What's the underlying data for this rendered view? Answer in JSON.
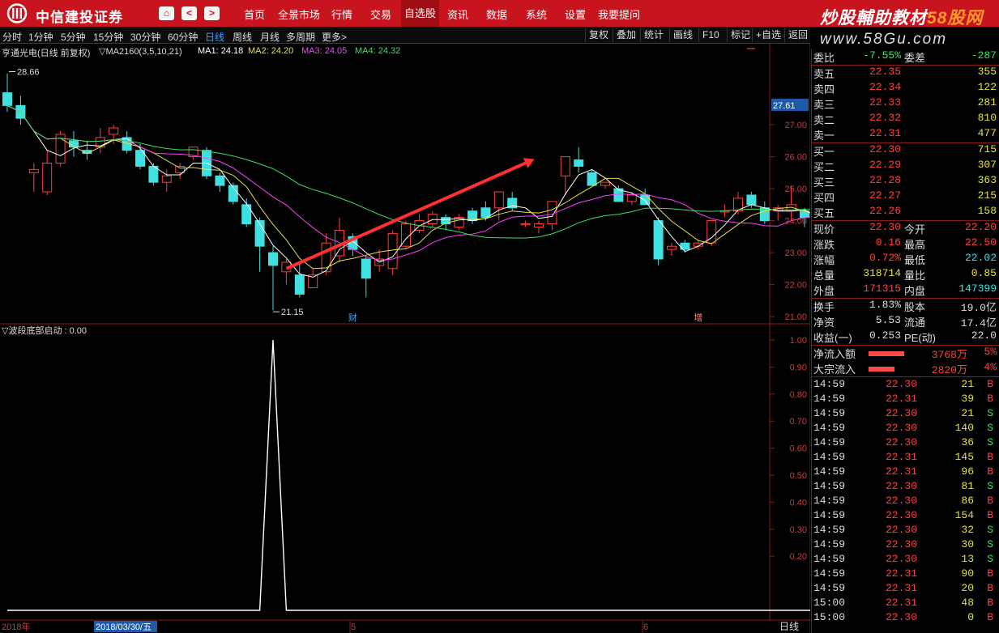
{
  "header": {
    "brand": "中信建投证券",
    "nav_back": "<",
    "nav_fwd": ">",
    "menus": [
      "首页",
      "全景市场",
      "行情",
      "交易",
      "自选股",
      "资讯",
      "数据",
      "系统",
      "设置",
      "我要提问"
    ],
    "active_menu": "自选股",
    "watermark1_a": "炒股輔助教材",
    "watermark1_b": "58股网",
    "watermark2": "www.58Gu.com"
  },
  "periods": [
    "分时",
    "1分钟",
    "5分钟",
    "15分钟",
    "30分钟",
    "60分钟",
    "日线",
    "周线",
    "月线",
    "多周期",
    "更多>"
  ],
  "selected_period": "日线",
  "tools": [
    "复权",
    "叠加",
    "统计",
    "画线",
    "F10",
    "标记",
    "+自选",
    "返回"
  ],
  "chart_title": "亨通光电(日线 前复权)",
  "ma_formula": "▽MA2160(3,5,10,21)",
  "ma_values": [
    "MA1: 24.18",
    "MA2: 24.20",
    "MA3: 24.05",
    "MA4: 24.32"
  ],
  "price_axis": [
    "27.00",
    "26.00",
    "25.00",
    "24.00",
    "23.00",
    "22.00",
    "21.00"
  ],
  "price_marker": "27.61",
  "high_label": "28.66",
  "low_label": "21.15",
  "event_cai": "财",
  "event_zeng": "增",
  "indicator_title": "▽波段底部启动 : 0.00",
  "indicator_axis": [
    "1.00",
    "0.90",
    "0.80",
    "0.70",
    "0.60",
    "0.50",
    "0.40",
    "0.30",
    "0.20"
  ],
  "date_left": "2018年",
  "date_cursor": "2018/03/30/五",
  "date_marks": [
    "5",
    "6"
  ],
  "bottom_tab": "日线",
  "colors": {
    "up": "#ff4040",
    "down": "#40e0e0",
    "ma1": "#ffffff",
    "ma2": "#e8e040",
    "ma3": "#ff40ff",
    "ma4": "#40e060",
    "arrow": "#ff3030"
  },
  "chart_data": {
    "type": "candlestick",
    "candles": [
      [
        28.0,
        28.6,
        27.4,
        27.6
      ],
      [
        27.6,
        27.9,
        27.0,
        27.2
      ],
      [
        25.5,
        25.8,
        24.9,
        25.6
      ],
      [
        24.9,
        26.2,
        24.8,
        25.8
      ],
      [
        25.8,
        26.8,
        25.7,
        26.7
      ],
      [
        26.5,
        26.8,
        26.0,
        26.3
      ],
      [
        26.2,
        26.5,
        25.9,
        26.1
      ],
      [
        26.3,
        26.9,
        26.1,
        26.6
      ],
      [
        26.7,
        27.0,
        26.4,
        26.9
      ],
      [
        26.6,
        26.8,
        26.1,
        26.2
      ],
      [
        26.2,
        26.4,
        25.6,
        25.7
      ],
      [
        25.7,
        25.8,
        25.1,
        25.2
      ],
      [
        25.2,
        25.6,
        24.9,
        25.4
      ],
      [
        25.5,
        25.8,
        25.3,
        25.7
      ],
      [
        26.0,
        26.3,
        25.9,
        26.3
      ],
      [
        26.2,
        26.3,
        25.3,
        25.4
      ],
      [
        25.4,
        25.5,
        24.9,
        25.1
      ],
      [
        25.1,
        25.2,
        24.5,
        24.6
      ],
      [
        24.5,
        24.7,
        23.8,
        23.9
      ],
      [
        24.0,
        24.1,
        22.4,
        23.2
      ],
      [
        23.0,
        23.2,
        21.2,
        22.6
      ],
      [
        22.4,
        22.8,
        22.0,
        22.7
      ],
      [
        22.3,
        22.7,
        21.6,
        21.7
      ],
      [
        21.9,
        22.5,
        21.9,
        22.3
      ],
      [
        22.4,
        23.6,
        22.3,
        23.3
      ],
      [
        22.9,
        24.1,
        22.7,
        23.7
      ],
      [
        23.5,
        23.6,
        22.9,
        23.1
      ],
      [
        22.8,
        22.9,
        21.6,
        22.2
      ],
      [
        22.6,
        23.1,
        22.4,
        22.8
      ],
      [
        22.5,
        23.7,
        22.3,
        23.6
      ],
      [
        23.2,
        24.0,
        23.1,
        23.9
      ],
      [
        23.7,
        24.2,
        23.6,
        24.0
      ],
      [
        23.9,
        24.3,
        23.8,
        24.2
      ],
      [
        24.1,
        24.2,
        23.7,
        23.9
      ],
      [
        23.8,
        24.2,
        23.7,
        24.1
      ],
      [
        24.3,
        24.4,
        23.9,
        24.0
      ],
      [
        24.4,
        24.6,
        24.0,
        24.1
      ],
      [
        24.4,
        24.9,
        24.0,
        24.9
      ],
      [
        24.7,
        24.9,
        24.3,
        24.4
      ],
      [
        23.9,
        24.0,
        23.8,
        23.9
      ],
      [
        23.8,
        24.0,
        23.6,
        23.9
      ],
      [
        23.9,
        24.6,
        23.7,
        24.6
      ],
      [
        25.4,
        26.0,
        24.8,
        26.0
      ],
      [
        25.9,
        26.3,
        25.5,
        25.7
      ],
      [
        25.5,
        25.6,
        25.1,
        25.1
      ],
      [
        25.1,
        25.2,
        25.0,
        25.2
      ],
      [
        25.0,
        25.1,
        24.6,
        24.6
      ],
      [
        24.6,
        24.9,
        24.5,
        24.8
      ],
      [
        24.8,
        25.0,
        24.5,
        24.5
      ],
      [
        24.0,
        24.1,
        22.6,
        22.8
      ],
      [
        23.1,
        23.3,
        22.9,
        23.2
      ],
      [
        23.3,
        23.4,
        23.0,
        23.1
      ],
      [
        23.2,
        23.4,
        23.1,
        23.3
      ],
      [
        23.3,
        24.0,
        23.2,
        24.0
      ],
      [
        24.3,
        24.5,
        24.1,
        24.3
      ],
      [
        24.3,
        24.9,
        24.2,
        24.7
      ],
      [
        24.8,
        24.9,
        24.4,
        24.5
      ],
      [
        24.4,
        24.6,
        23.9,
        24.0
      ],
      [
        24.3,
        24.5,
        24.0,
        24.4
      ],
      [
        24.3,
        25.1,
        24.0,
        24.5
      ],
      [
        24.3,
        24.4,
        23.8,
        24.1
      ],
      [
        24.1,
        24.2,
        23.7,
        23.8
      ]
    ],
    "indicator_peak_index": 20,
    "indicator_values": "0 except 1.00 at peak",
    "ylim": [
      20.8,
      28.9
    ],
    "indicator_ylim": [
      0,
      1
    ]
  },
  "quote": {
    "weibi_label": "委比",
    "weibi": "-7.55%",
    "weicha_label": "委差",
    "weicha": "-287",
    "asks": [
      [
        "卖五",
        "22.35",
        "355"
      ],
      [
        "卖四",
        "22.34",
        "122"
      ],
      [
        "卖三",
        "22.33",
        "281"
      ],
      [
        "卖二",
        "22.32",
        "810"
      ],
      [
        "卖一",
        "22.31",
        "477"
      ]
    ],
    "bids": [
      [
        "买一",
        "22.30",
        "715"
      ],
      [
        "买二",
        "22.29",
        "307"
      ],
      [
        "买三",
        "22.28",
        "363"
      ],
      [
        "买四",
        "22.27",
        "215"
      ],
      [
        "买五",
        "22.26",
        "158"
      ]
    ],
    "stats": [
      [
        "现价",
        "22.30",
        "今开",
        "22.20"
      ],
      [
        "涨跌",
        "0.16",
        "最高",
        "22.50"
      ],
      [
        "涨幅",
        "0.72%",
        "最低",
        "22.02"
      ],
      [
        "总量",
        "318714",
        "量比",
        "0.85"
      ],
      [
        "外盘",
        "171315",
        "内盘",
        "147399"
      ]
    ],
    "stats2": [
      [
        "换手",
        "1.83%",
        "股本",
        "19.0亿"
      ],
      [
        "净资",
        "5.53",
        "流通",
        "17.4亿"
      ],
      [
        "收益(一)",
        "0.253",
        "PE(动)",
        "22.0"
      ]
    ],
    "flows": [
      [
        "净流入额",
        "3768万",
        "5%"
      ],
      [
        "大宗流入",
        "2820万",
        "4%"
      ]
    ],
    "ticks": [
      [
        "14:59",
        "22.30",
        "21",
        "B"
      ],
      [
        "14:59",
        "22.31",
        "39",
        "B"
      ],
      [
        "14:59",
        "22.30",
        "21",
        "S"
      ],
      [
        "14:59",
        "22.30",
        "140",
        "S"
      ],
      [
        "14:59",
        "22.30",
        "36",
        "S"
      ],
      [
        "14:59",
        "22.31",
        "145",
        "B"
      ],
      [
        "14:59",
        "22.31",
        "96",
        "B"
      ],
      [
        "14:59",
        "22.30",
        "81",
        "S"
      ],
      [
        "14:59",
        "22.30",
        "86",
        "B"
      ],
      [
        "14:59",
        "22.30",
        "154",
        "B"
      ],
      [
        "14:59",
        "22.30",
        "32",
        "S"
      ],
      [
        "14:59",
        "22.30",
        "30",
        "S"
      ],
      [
        "14:59",
        "22.30",
        "13",
        "S"
      ],
      [
        "14:59",
        "22.31",
        "90",
        "B"
      ],
      [
        "14:59",
        "22.31",
        "20",
        "B"
      ],
      [
        "15:00",
        "22.31",
        "48",
        "B"
      ],
      [
        "15:00",
        "22.30",
        "0",
        "B"
      ]
    ]
  }
}
